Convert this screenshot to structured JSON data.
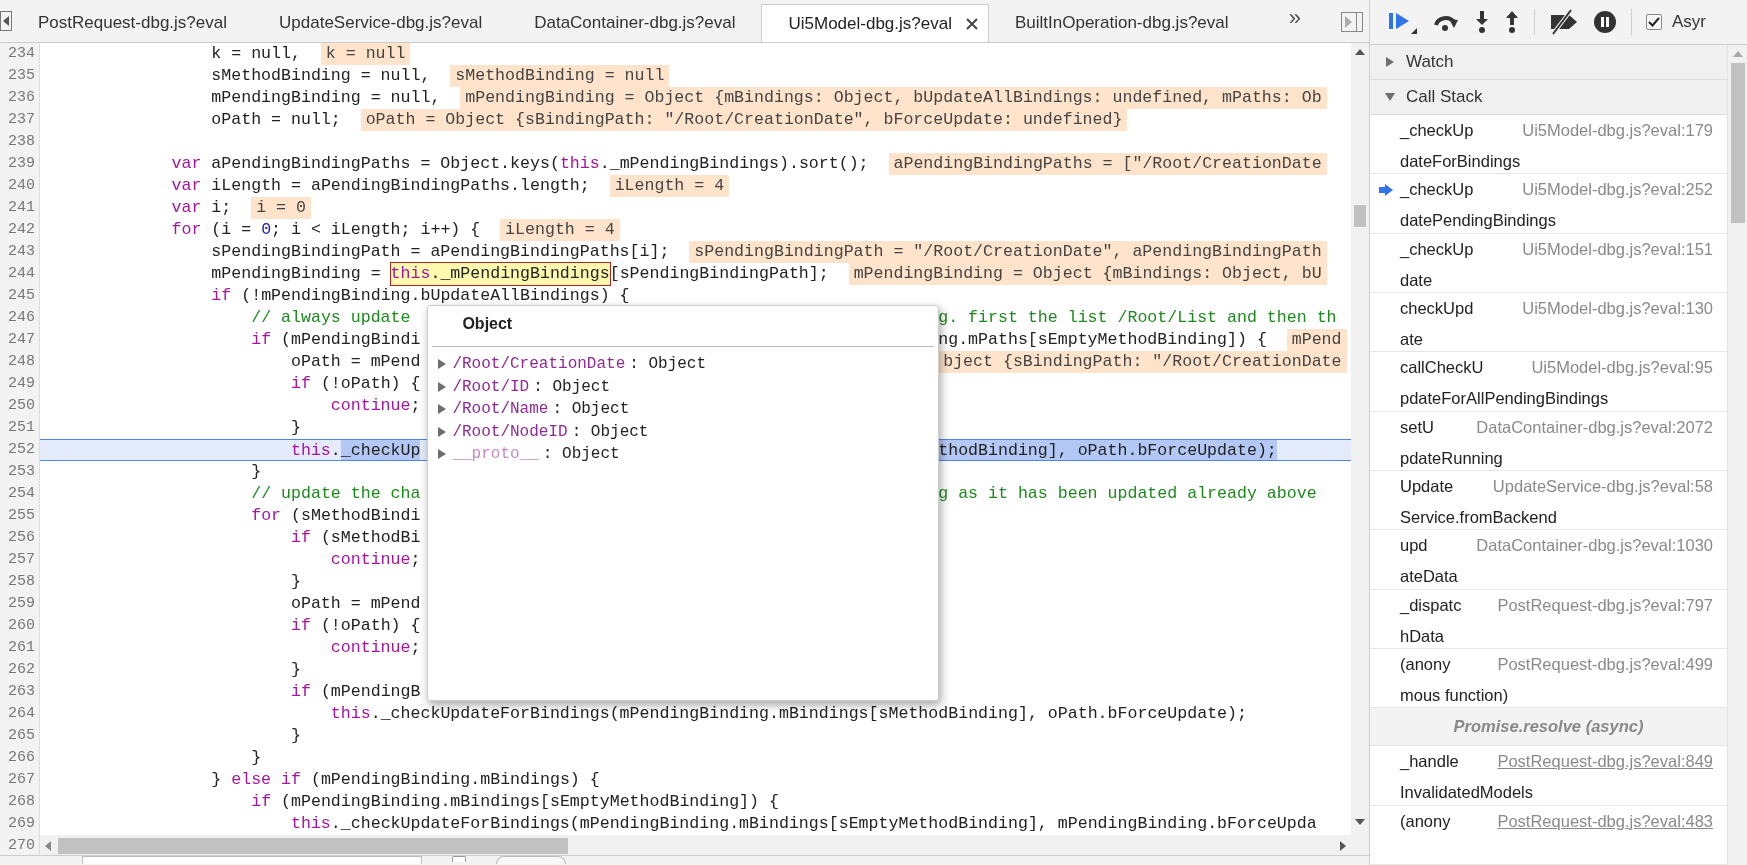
{
  "tabs": [
    {
      "label": "PostRequest-dbg.js?eval",
      "selected": false
    },
    {
      "label": "UpdateService-dbg.js?eval",
      "selected": false
    },
    {
      "label": "DataContainer-dbg.js?eval",
      "selected": false
    },
    {
      "label": "Ui5Model-dbg.js?eval",
      "selected": true
    },
    {
      "label": "BuiltInOperation-dbg.js?eval",
      "selected": false
    }
  ],
  "more_tabs": "»",
  "editor": {
    "lines": [
      {
        "number": "234",
        "current": false,
        "segments": [
          {
            "kind": "code",
            "text": "                k = null,"
          },
          {
            "kind": "value",
            "text": "k = null"
          }
        ]
      },
      {
        "number": "235",
        "current": false,
        "segments": [
          {
            "kind": "code",
            "text": "                sMethodBinding = null,"
          },
          {
            "kind": "value",
            "text": "sMethodBinding = null"
          }
        ]
      },
      {
        "number": "236",
        "current": false,
        "segments": [
          {
            "kind": "code",
            "text": "                mPendingBinding = null,"
          },
          {
            "kind": "value",
            "text": "mPendingBinding = Object {mBindings: Object, bUpdateAllBindings: undefined, mPaths: Ob"
          }
        ]
      },
      {
        "number": "237",
        "current": false,
        "segments": [
          {
            "kind": "code",
            "text": "                oPath = null;"
          },
          {
            "kind": "value",
            "text": "oPath = Object {sBindingPath: \"/Root/CreationDate\", bForceUpdate: undefined}"
          }
        ]
      },
      {
        "number": "238",
        "current": false
      },
      {
        "number": "239",
        "current": false,
        "segments": [
          {
            "kind": "keyword",
            "text": "            var"
          },
          {
            "kind": "code",
            "text": " aPendingBindingPaths = Object.keys("
          },
          {
            "kind": "keyword",
            "text": "this"
          },
          {
            "kind": "code",
            "text": "._mPendingBindings).sort();"
          },
          {
            "kind": "value",
            "text": "aPendingBindingPaths = [\"/Root/CreationDate"
          }
        ]
      },
      {
        "number": "240",
        "current": false,
        "segments": [
          {
            "kind": "keyword",
            "text": "            var"
          },
          {
            "kind": "code",
            "text": " iLength = aPendingBindingPaths.length;"
          },
          {
            "kind": "value",
            "text": "iLength = 4"
          }
        ]
      },
      {
        "number": "241",
        "current": false,
        "segments": [
          {
            "kind": "keyword",
            "text": "            var"
          },
          {
            "kind": "code",
            "text": " i;"
          },
          {
            "kind": "value",
            "text": "i = 0"
          }
        ]
      },
      {
        "number": "242",
        "current": false,
        "segments": [
          {
            "kind": "keyword",
            "text": "            for"
          },
          {
            "kind": "code",
            "text": " (i = "
          },
          {
            "kind": "number",
            "text": "0"
          },
          {
            "kind": "code",
            "text": "; i < iLength; i++) {"
          },
          {
            "kind": "value",
            "text": "iLength = 4"
          }
        ]
      },
      {
        "number": "243",
        "current": false,
        "segments": [
          {
            "kind": "code",
            "text": "                sPendingBindingPath = aPendingBindingPaths[i];"
          },
          {
            "kind": "value",
            "text": "sPendingBindingPath = \"/Root/CreationDate\", aPendingBindingPath"
          }
        ]
      },
      {
        "number": "244",
        "current": false,
        "segments": [
          {
            "kind": "code",
            "text": "                mPendingBinding = "
          },
          {
            "kind": "hover",
            "segments": [
              {
                "kind": "keyword",
                "text": "this"
              },
              {
                "kind": "code",
                "text": "._mPendingBindings"
              }
            ]
          },
          {
            "kind": "code",
            "text": "[sPendingBindingPath];"
          },
          {
            "kind": "value",
            "text": "mPendingBinding = Object {mBindings: Object, bU"
          }
        ]
      },
      {
        "number": "245",
        "current": false,
        "segments": [
          {
            "kind": "keyword",
            "text": "                if"
          },
          {
            "kind": "code",
            "text": " (!mPendingBinding.bUpdateAllBindings) {"
          }
        ]
      },
      {
        "number": "246",
        "current": false,
        "segments": [
          {
            "kind": "comment",
            "text": "                    // always update"
          }
        ],
        "right": [
          {
            "kind": "comment",
            "text": "g. first the list /Root/List and then th"
          }
        ]
      },
      {
        "number": "247",
        "current": false,
        "segments": [
          {
            "kind": "keyword",
            "text": "                    if"
          },
          {
            "kind": "code",
            "text": " (mPendingBindi"
          }
        ],
        "right": [
          {
            "kind": "code",
            "text": "ng.mPaths[sEmptyMethodBinding]) {"
          },
          {
            "kind": "value",
            "text": "mPend"
          }
        ]
      },
      {
        "number": "248",
        "current": false,
        "segments": [
          {
            "kind": "code",
            "text": "                        oPath = mPend"
          }
        ],
        "right": [
          {
            "kind": "value",
            "text": "bject {sBindingPath: \"/Root/CreationDate"
          }
        ]
      },
      {
        "number": "249",
        "current": false,
        "segments": [
          {
            "kind": "keyword",
            "text": "                        if"
          },
          {
            "kind": "code",
            "text": " (!oPath) {"
          }
        ]
      },
      {
        "number": "250",
        "current": false,
        "segments": [
          {
            "kind": "keyword",
            "text": "                            continue"
          },
          {
            "kind": "code",
            "text": ";"
          }
        ]
      },
      {
        "number": "251",
        "current": false,
        "segments": [
          {
            "kind": "code",
            "text": "                        }"
          }
        ]
      },
      {
        "number": "252",
        "current": true,
        "segments": [
          {
            "kind": "keyword",
            "text": "                        this"
          },
          {
            "kind": "code",
            "text": "."
          },
          {
            "kind": "selection",
            "text": "_checkUp"
          }
        ],
        "right": [
          {
            "kind": "selection",
            "text": "thodBinding], oPath.bForceUpdate);"
          }
        ]
      },
      {
        "number": "253",
        "current": false,
        "segments": [
          {
            "kind": "code",
            "text": "                    }"
          }
        ]
      },
      {
        "number": "254",
        "current": false,
        "segments": [
          {
            "kind": "comment",
            "text": "                    // update the cha"
          }
        ],
        "right": [
          {
            "kind": "comment",
            "text": "g as it has been updated already above"
          }
        ]
      },
      {
        "number": "255",
        "current": false,
        "segments": [
          {
            "kind": "keyword",
            "text": "                    for"
          },
          {
            "kind": "code",
            "text": " (sMethodBindi"
          }
        ]
      },
      {
        "number": "256",
        "current": false,
        "segments": [
          {
            "kind": "keyword",
            "text": "                        if"
          },
          {
            "kind": "code",
            "text": " (sMethodBi"
          }
        ]
      },
      {
        "number": "257",
        "current": false,
        "segments": [
          {
            "kind": "keyword",
            "text": "                            continue"
          },
          {
            "kind": "code",
            "text": ";"
          }
        ]
      },
      {
        "number": "258",
        "current": false,
        "segments": [
          {
            "kind": "code",
            "text": "                        }"
          }
        ]
      },
      {
        "number": "259",
        "current": false,
        "segments": [
          {
            "kind": "code",
            "text": "                        oPath = mPend"
          }
        ]
      },
      {
        "number": "260",
        "current": false,
        "segments": [
          {
            "kind": "keyword",
            "text": "                        if"
          },
          {
            "kind": "code",
            "text": " (!oPath) {"
          }
        ]
      },
      {
        "number": "261",
        "current": false,
        "segments": [
          {
            "kind": "keyword",
            "text": "                            continue"
          },
          {
            "kind": "code",
            "text": ";"
          }
        ]
      },
      {
        "number": "262",
        "current": false,
        "segments": [
          {
            "kind": "code",
            "text": "                        }"
          }
        ]
      },
      {
        "number": "263",
        "current": false,
        "segments": [
          {
            "kind": "keyword",
            "text": "                        if"
          },
          {
            "kind": "code",
            "text": " (mPendingB"
          }
        ]
      },
      {
        "number": "264",
        "current": false,
        "segments": [
          {
            "kind": "keyword",
            "text": "                            this"
          },
          {
            "kind": "code",
            "text": "._checkUpdateForBindings(mPendingBinding.mBindings[sMethodBinding], oPath.bForceUpdate);"
          }
        ]
      },
      {
        "number": "265",
        "current": false,
        "segments": [
          {
            "kind": "code",
            "text": "                        }"
          }
        ]
      },
      {
        "number": "266",
        "current": false,
        "segments": [
          {
            "kind": "code",
            "text": "                    }"
          }
        ]
      },
      {
        "number": "267",
        "current": false,
        "segments": [
          {
            "kind": "code",
            "text": "                } "
          },
          {
            "kind": "keyword",
            "text": "else if"
          },
          {
            "kind": "code",
            "text": " (mPendingBinding.mBindings) {"
          }
        ]
      },
      {
        "number": "268",
        "current": false,
        "segments": [
          {
            "kind": "keyword",
            "text": "                    if"
          },
          {
            "kind": "code",
            "text": " (mPendingBinding.mBindings[sEmptyMethodBinding]) {"
          }
        ]
      },
      {
        "number": "269",
        "current": false,
        "segments": [
          {
            "kind": "keyword",
            "text": "                        this"
          },
          {
            "kind": "code",
            "text": "._checkUpdateForBindings(mPendingBinding.mBindings[sEmptyMethodBinding], mPendingBinding.bForceUpda"
          }
        ]
      }
    ],
    "last_line_number": "270",
    "popup": {
      "title": "Object",
      "entries": [
        {
          "key": "/Root/CreationDate",
          "value": ": Object",
          "dimmed": false
        },
        {
          "key": "/Root/ID",
          "value": ": Object",
          "dimmed": false
        },
        {
          "key": "/Root/Name",
          "value": ": Object",
          "dimmed": false
        },
        {
          "key": "/Root/NodeID",
          "value": ": Object",
          "dimmed": false
        },
        {
          "key": "__proto__",
          "value": ": Object",
          "dimmed": true
        }
      ]
    }
  },
  "bottom_bar": {
    "checkbox": {
      "checked": false
    }
  },
  "debugger": {
    "async": {
      "label": "Asyr",
      "checked": true
    },
    "sections": [
      {
        "title": "Watch",
        "expanded": false
      },
      {
        "title": "Call Stack",
        "expanded": true
      }
    ],
    "frames": [
      {
        "kind": "frame",
        "name_lines": [
          "_checkUp",
          "dateForBindings"
        ],
        "location": "Ui5Model-dbg.js?eval:179",
        "current": false,
        "link": false
      },
      {
        "kind": "frame",
        "name_lines": [
          "_checkUp",
          "datePendingBindings"
        ],
        "location": "Ui5Model-dbg.js?eval:252",
        "current": true,
        "link": false
      },
      {
        "kind": "frame",
        "name_lines": [
          "_checkUp",
          "date"
        ],
        "location": "Ui5Model-dbg.js?eval:151",
        "current": false,
        "link": false
      },
      {
        "kind": "frame",
        "name_lines": [
          "checkUpd",
          "ate"
        ],
        "location": "Ui5Model-dbg.js?eval:130",
        "current": false,
        "link": false
      },
      {
        "kind": "frame",
        "name_lines": [
          "callCheckU",
          "pdateForAllPendingBindings"
        ],
        "location": "Ui5Model-dbg.js?eval:95",
        "current": false,
        "link": false
      },
      {
        "kind": "frame",
        "name_lines": [
          "setU",
          "pdateRunning"
        ],
        "location": "DataContainer-dbg.js?eval:2072",
        "current": false,
        "link": false
      },
      {
        "kind": "frame",
        "name_lines": [
          "Update",
          "Service.fromBackend"
        ],
        "location": "UpdateService-dbg.js?eval:58",
        "current": false,
        "link": false
      },
      {
        "kind": "frame",
        "name_lines": [
          "upd",
          "ateData"
        ],
        "location": "DataContainer-dbg.js?eval:1030",
        "current": false,
        "link": false
      },
      {
        "kind": "frame",
        "name_lines": [
          "_dispatc",
          "hData"
        ],
        "location": "PostRequest-dbg.js?eval:797",
        "current": false,
        "link": false
      },
      {
        "kind": "frame",
        "name_lines": [
          "(anony",
          "mous function)"
        ],
        "location": "PostRequest-dbg.js?eval:499",
        "current": false,
        "link": false
      },
      {
        "kind": "async",
        "name": "Promise.resolve (async)"
      },
      {
        "kind": "frame",
        "name_lines": [
          "_handle",
          "InvalidatedModels"
        ],
        "location": "PostRequest-dbg.js?eval:849",
        "current": false,
        "link": true
      },
      {
        "kind": "frame",
        "name_lines": [
          "(anony"
        ],
        "location": "PostRequest-dbg.js?eval:483",
        "current": false,
        "link": true
      }
    ]
  }
}
